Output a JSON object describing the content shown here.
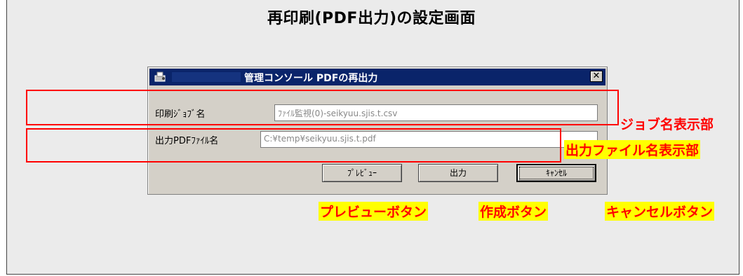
{
  "page": {
    "heading": "再印刷(PDF出力)の設定画面"
  },
  "dialog": {
    "title": "管理コンソール PDFの再出力",
    "close_label": "✕",
    "job_label": "印刷ｼﾞｮﾌﾞ名",
    "job_value": "ﾌｧｲﾙ監視(0)-seikyuu.sjis.t.csv",
    "file_label": "出力PDFﾌｧｲﾙ名",
    "file_value": "C:¥temp¥seikyuu.sjis.t.pdf",
    "buttons": {
      "preview": "ﾌﾟﾚﾋﾞｭｰ",
      "output": "出力",
      "cancel": "ｷｬﾝｾﾙ"
    }
  },
  "annotations": {
    "job_area": "ジョブ名表示部",
    "file_area": "出力ファイル名表示部",
    "preview_button": "プレビューボタン",
    "create_button": "作成ボタン",
    "cancel_button": "キャンセルボタン"
  },
  "colors": {
    "titlebar": "#0a246a",
    "annotation_red": "#ff0000",
    "highlight_yellow": "#ffff00",
    "dialog_face": "#d4d0c8"
  }
}
